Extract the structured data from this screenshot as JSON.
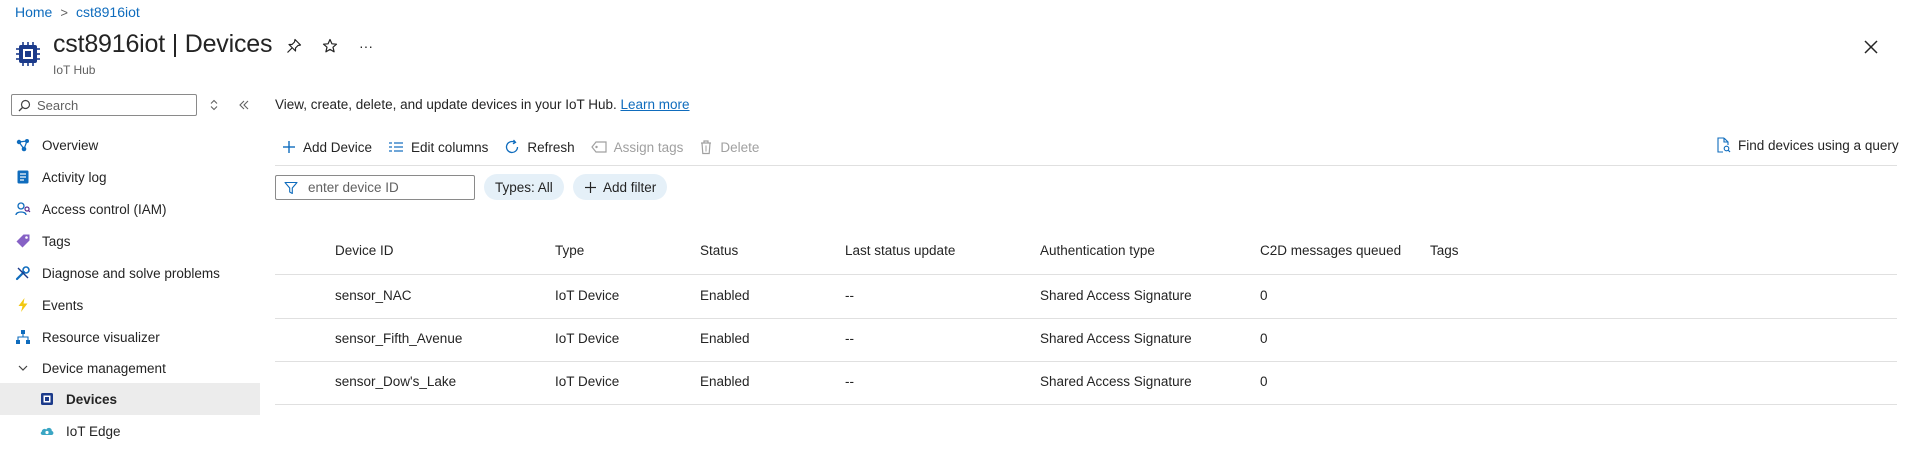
{
  "breadcrumb": {
    "home": "Home",
    "current": "cst8916iot"
  },
  "header": {
    "title": "cst8916iot | Devices",
    "subtitle": "IoT Hub",
    "more": "···"
  },
  "sidebar": {
    "search_placeholder": "Search",
    "items": [
      {
        "label": "Overview",
        "icon": "overview-icon"
      },
      {
        "label": "Activity log",
        "icon": "activity-log-icon"
      },
      {
        "label": "Access control (IAM)",
        "icon": "iam-icon"
      },
      {
        "label": "Tags",
        "icon": "tag-icon"
      },
      {
        "label": "Diagnose and solve problems",
        "icon": "wrench-icon"
      },
      {
        "label": "Events",
        "icon": "lightning-icon"
      },
      {
        "label": "Resource visualizer",
        "icon": "visualizer-icon"
      },
      {
        "label": "Device management",
        "icon": "chevron-down-icon"
      },
      {
        "label": "Devices",
        "icon": "chip-icon",
        "active": true
      },
      {
        "label": "IoT Edge",
        "icon": "cloud-icon"
      }
    ]
  },
  "main": {
    "description": "View, create, delete, and update devices in your IoT Hub.",
    "learn_more": "Learn more",
    "toolbar": {
      "add_device": "Add Device",
      "edit_columns": "Edit columns",
      "refresh": "Refresh",
      "assign_tags": "Assign tags",
      "delete": "Delete",
      "find_devices": "Find devices using a query"
    },
    "filter": {
      "placeholder": "enter device ID",
      "types_pill": "Types: All",
      "add_filter": "Add filter"
    },
    "table": {
      "columns": [
        "Device ID",
        "Type",
        "Status",
        "Last status update",
        "Authentication type",
        "C2D messages queued",
        "Tags"
      ],
      "rows": [
        {
          "device_id": "sensor_NAC",
          "type": "IoT Device",
          "status": "Enabled",
          "last_update": "--",
          "auth": "Shared Access Signature",
          "c2d": "0",
          "tags": ""
        },
        {
          "device_id": "sensor_Fifth_Avenue",
          "type": "IoT Device",
          "status": "Enabled",
          "last_update": "--",
          "auth": "Shared Access Signature",
          "c2d": "0",
          "tags": ""
        },
        {
          "device_id": "sensor_Dow's_Lake",
          "type": "IoT Device",
          "status": "Enabled",
          "last_update": "--",
          "auth": "Shared Access Signature",
          "c2d": "0",
          "tags": ""
        }
      ]
    }
  },
  "colors": {
    "accent": "#0f6cbd",
    "pill_bg": "#e5f0f8",
    "nav_active_bg": "#ececec"
  }
}
